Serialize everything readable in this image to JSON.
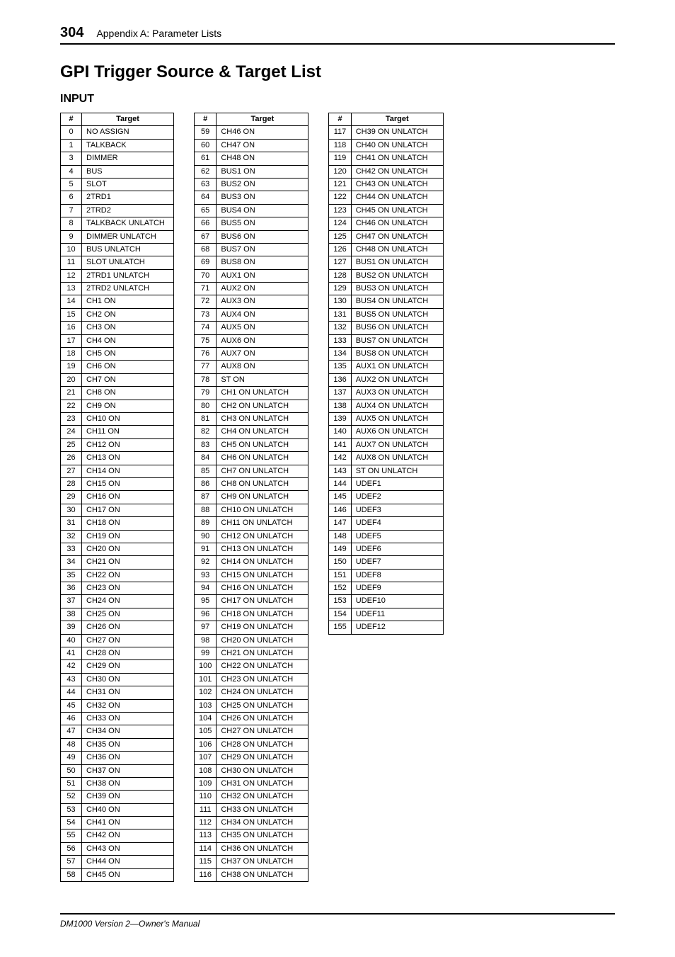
{
  "pageNumber": "304",
  "appendixTitle": "Appendix A: Parameter Lists",
  "mainHeading": "GPI Trigger Source & Target List",
  "subHeading": "INPUT",
  "columns": {
    "hash": "#",
    "target": "Target"
  },
  "footer": "DM1000 Version 2—Owner's Manual",
  "table1": [
    {
      "n": "0",
      "t": "NO ASSIGN"
    },
    {
      "n": "1",
      "t": "TALKBACK"
    },
    {
      "n": "3",
      "t": "DIMMER"
    },
    {
      "n": "4",
      "t": "BUS"
    },
    {
      "n": "5",
      "t": "SLOT"
    },
    {
      "n": "6",
      "t": "2TRD1"
    },
    {
      "n": "7",
      "t": "2TRD2"
    },
    {
      "n": "8",
      "t": "TALKBACK UNLATCH"
    },
    {
      "n": "9",
      "t": "DIMMER UNLATCH"
    },
    {
      "n": "10",
      "t": "BUS UNLATCH"
    },
    {
      "n": "11",
      "t": "SLOT UNLATCH"
    },
    {
      "n": "12",
      "t": "2TRD1 UNLATCH"
    },
    {
      "n": "13",
      "t": "2TRD2 UNLATCH"
    },
    {
      "n": "14",
      "t": "CH1 ON"
    },
    {
      "n": "15",
      "t": "CH2 ON"
    },
    {
      "n": "16",
      "t": "CH3 ON"
    },
    {
      "n": "17",
      "t": "CH4 ON"
    },
    {
      "n": "18",
      "t": "CH5 ON"
    },
    {
      "n": "19",
      "t": "CH6 ON"
    },
    {
      "n": "20",
      "t": "CH7 ON"
    },
    {
      "n": "21",
      "t": "CH8 ON"
    },
    {
      "n": "22",
      "t": "CH9 ON"
    },
    {
      "n": "23",
      "t": "CH10 ON"
    },
    {
      "n": "24",
      "t": "CH11 ON"
    },
    {
      "n": "25",
      "t": "CH12 ON"
    },
    {
      "n": "26",
      "t": "CH13 ON"
    },
    {
      "n": "27",
      "t": "CH14 ON"
    },
    {
      "n": "28",
      "t": "CH15 ON"
    },
    {
      "n": "29",
      "t": "CH16 ON"
    },
    {
      "n": "30",
      "t": "CH17 ON"
    },
    {
      "n": "31",
      "t": "CH18 ON"
    },
    {
      "n": "32",
      "t": "CH19 ON"
    },
    {
      "n": "33",
      "t": "CH20 ON"
    },
    {
      "n": "34",
      "t": "CH21 ON"
    },
    {
      "n": "35",
      "t": "CH22 ON"
    },
    {
      "n": "36",
      "t": "CH23 ON"
    },
    {
      "n": "37",
      "t": "CH24 ON"
    },
    {
      "n": "38",
      "t": "CH25 ON"
    },
    {
      "n": "39",
      "t": "CH26 ON"
    },
    {
      "n": "40",
      "t": "CH27 ON"
    },
    {
      "n": "41",
      "t": "CH28 ON"
    },
    {
      "n": "42",
      "t": "CH29 ON"
    },
    {
      "n": "43",
      "t": "CH30 ON"
    },
    {
      "n": "44",
      "t": "CH31 ON"
    },
    {
      "n": "45",
      "t": "CH32 ON"
    },
    {
      "n": "46",
      "t": "CH33 ON"
    },
    {
      "n": "47",
      "t": "CH34 ON"
    },
    {
      "n": "48",
      "t": "CH35 ON"
    },
    {
      "n": "49",
      "t": "CH36 ON"
    },
    {
      "n": "50",
      "t": "CH37 ON"
    },
    {
      "n": "51",
      "t": "CH38 ON"
    },
    {
      "n": "52",
      "t": "CH39 ON"
    },
    {
      "n": "53",
      "t": "CH40 ON"
    },
    {
      "n": "54",
      "t": "CH41 ON"
    },
    {
      "n": "55",
      "t": "CH42 ON"
    },
    {
      "n": "56",
      "t": "CH43 ON"
    },
    {
      "n": "57",
      "t": "CH44 ON"
    },
    {
      "n": "58",
      "t": "CH45 ON"
    }
  ],
  "table2": [
    {
      "n": "59",
      "t": "CH46 ON"
    },
    {
      "n": "60",
      "t": "CH47 ON"
    },
    {
      "n": "61",
      "t": "CH48 ON"
    },
    {
      "n": "62",
      "t": "BUS1 ON"
    },
    {
      "n": "63",
      "t": "BUS2 ON"
    },
    {
      "n": "64",
      "t": "BUS3 ON"
    },
    {
      "n": "65",
      "t": "BUS4 ON"
    },
    {
      "n": "66",
      "t": "BUS5 ON"
    },
    {
      "n": "67",
      "t": "BUS6 ON"
    },
    {
      "n": "68",
      "t": "BUS7 ON"
    },
    {
      "n": "69",
      "t": "BUS8 ON"
    },
    {
      "n": "70",
      "t": "AUX1 ON"
    },
    {
      "n": "71",
      "t": "AUX2 ON"
    },
    {
      "n": "72",
      "t": "AUX3 ON"
    },
    {
      "n": "73",
      "t": "AUX4 ON"
    },
    {
      "n": "74",
      "t": "AUX5 ON"
    },
    {
      "n": "75",
      "t": "AUX6 ON"
    },
    {
      "n": "76",
      "t": "AUX7 ON"
    },
    {
      "n": "77",
      "t": "AUX8 ON"
    },
    {
      "n": "78",
      "t": "ST ON"
    },
    {
      "n": "79",
      "t": "CH1 ON UNLATCH"
    },
    {
      "n": "80",
      "t": "CH2 ON UNLATCH"
    },
    {
      "n": "81",
      "t": "CH3 ON UNLATCH"
    },
    {
      "n": "82",
      "t": "CH4 ON UNLATCH"
    },
    {
      "n": "83",
      "t": "CH5 ON UNLATCH"
    },
    {
      "n": "84",
      "t": "CH6 ON UNLATCH"
    },
    {
      "n": "85",
      "t": "CH7 ON UNLATCH"
    },
    {
      "n": "86",
      "t": "CH8 ON UNLATCH"
    },
    {
      "n": "87",
      "t": "CH9 ON UNLATCH"
    },
    {
      "n": "88",
      "t": "CH10 ON UNLATCH"
    },
    {
      "n": "89",
      "t": "CH11 ON UNLATCH"
    },
    {
      "n": "90",
      "t": "CH12 ON UNLATCH"
    },
    {
      "n": "91",
      "t": "CH13 ON UNLATCH"
    },
    {
      "n": "92",
      "t": "CH14 ON UNLATCH"
    },
    {
      "n": "93",
      "t": "CH15 ON UNLATCH"
    },
    {
      "n": "94",
      "t": "CH16 ON UNLATCH"
    },
    {
      "n": "95",
      "t": "CH17 ON UNLATCH"
    },
    {
      "n": "96",
      "t": "CH18 ON UNLATCH"
    },
    {
      "n": "97",
      "t": "CH19 ON UNLATCH"
    },
    {
      "n": "98",
      "t": "CH20 ON UNLATCH"
    },
    {
      "n": "99",
      "t": "CH21 ON UNLATCH"
    },
    {
      "n": "100",
      "t": "CH22 ON UNLATCH"
    },
    {
      "n": "101",
      "t": "CH23 ON UNLATCH"
    },
    {
      "n": "102",
      "t": "CH24 ON UNLATCH"
    },
    {
      "n": "103",
      "t": "CH25 ON UNLATCH"
    },
    {
      "n": "104",
      "t": "CH26 ON UNLATCH"
    },
    {
      "n": "105",
      "t": "CH27 ON UNLATCH"
    },
    {
      "n": "106",
      "t": "CH28 ON UNLATCH"
    },
    {
      "n": "107",
      "t": "CH29 ON UNLATCH"
    },
    {
      "n": "108",
      "t": "CH30 ON UNLATCH"
    },
    {
      "n": "109",
      "t": "CH31 ON UNLATCH"
    },
    {
      "n": "110",
      "t": "CH32 ON UNLATCH"
    },
    {
      "n": "111",
      "t": "CH33 ON UNLATCH"
    },
    {
      "n": "112",
      "t": "CH34 ON UNLATCH"
    },
    {
      "n": "113",
      "t": "CH35 ON UNLATCH"
    },
    {
      "n": "114",
      "t": "CH36 ON UNLATCH"
    },
    {
      "n": "115",
      "t": "CH37 ON UNLATCH"
    },
    {
      "n": "116",
      "t": "CH38 ON UNLATCH"
    }
  ],
  "table3": [
    {
      "n": "117",
      "t": "CH39 ON UNLATCH"
    },
    {
      "n": "118",
      "t": "CH40 ON UNLATCH"
    },
    {
      "n": "119",
      "t": "CH41 ON UNLATCH"
    },
    {
      "n": "120",
      "t": "CH42 ON UNLATCH"
    },
    {
      "n": "121",
      "t": "CH43 ON UNLATCH"
    },
    {
      "n": "122",
      "t": "CH44 ON UNLATCH"
    },
    {
      "n": "123",
      "t": "CH45 ON UNLATCH"
    },
    {
      "n": "124",
      "t": "CH46 ON UNLATCH"
    },
    {
      "n": "125",
      "t": "CH47 ON UNLATCH"
    },
    {
      "n": "126",
      "t": "CH48 ON UNLATCH"
    },
    {
      "n": "127",
      "t": "BUS1 ON UNLATCH"
    },
    {
      "n": "128",
      "t": "BUS2 ON UNLATCH"
    },
    {
      "n": "129",
      "t": "BUS3 ON UNLATCH"
    },
    {
      "n": "130",
      "t": "BUS4 ON UNLATCH"
    },
    {
      "n": "131",
      "t": "BUS5 ON UNLATCH"
    },
    {
      "n": "132",
      "t": "BUS6 ON UNLATCH"
    },
    {
      "n": "133",
      "t": "BUS7 ON UNLATCH"
    },
    {
      "n": "134",
      "t": "BUS8 ON UNLATCH"
    },
    {
      "n": "135",
      "t": "AUX1 ON UNLATCH"
    },
    {
      "n": "136",
      "t": "AUX2 ON UNLATCH"
    },
    {
      "n": "137",
      "t": "AUX3 ON UNLATCH"
    },
    {
      "n": "138",
      "t": "AUX4 ON UNLATCH"
    },
    {
      "n": "139",
      "t": "AUX5 ON UNLATCH"
    },
    {
      "n": "140",
      "t": "AUX6 ON UNLATCH"
    },
    {
      "n": "141",
      "t": "AUX7 ON UNLATCH"
    },
    {
      "n": "142",
      "t": "AUX8 ON UNLATCH"
    },
    {
      "n": "143",
      "t": "ST ON UNLATCH"
    },
    {
      "n": "144",
      "t": "UDEF1"
    },
    {
      "n": "145",
      "t": "UDEF2"
    },
    {
      "n": "146",
      "t": "UDEF3"
    },
    {
      "n": "147",
      "t": "UDEF4"
    },
    {
      "n": "148",
      "t": "UDEF5"
    },
    {
      "n": "149",
      "t": "UDEF6"
    },
    {
      "n": "150",
      "t": "UDEF7"
    },
    {
      "n": "151",
      "t": "UDEF8"
    },
    {
      "n": "152",
      "t": "UDEF9"
    },
    {
      "n": "153",
      "t": "UDEF10"
    },
    {
      "n": "154",
      "t": "UDEF11"
    },
    {
      "n": "155",
      "t": "UDEF12"
    }
  ]
}
